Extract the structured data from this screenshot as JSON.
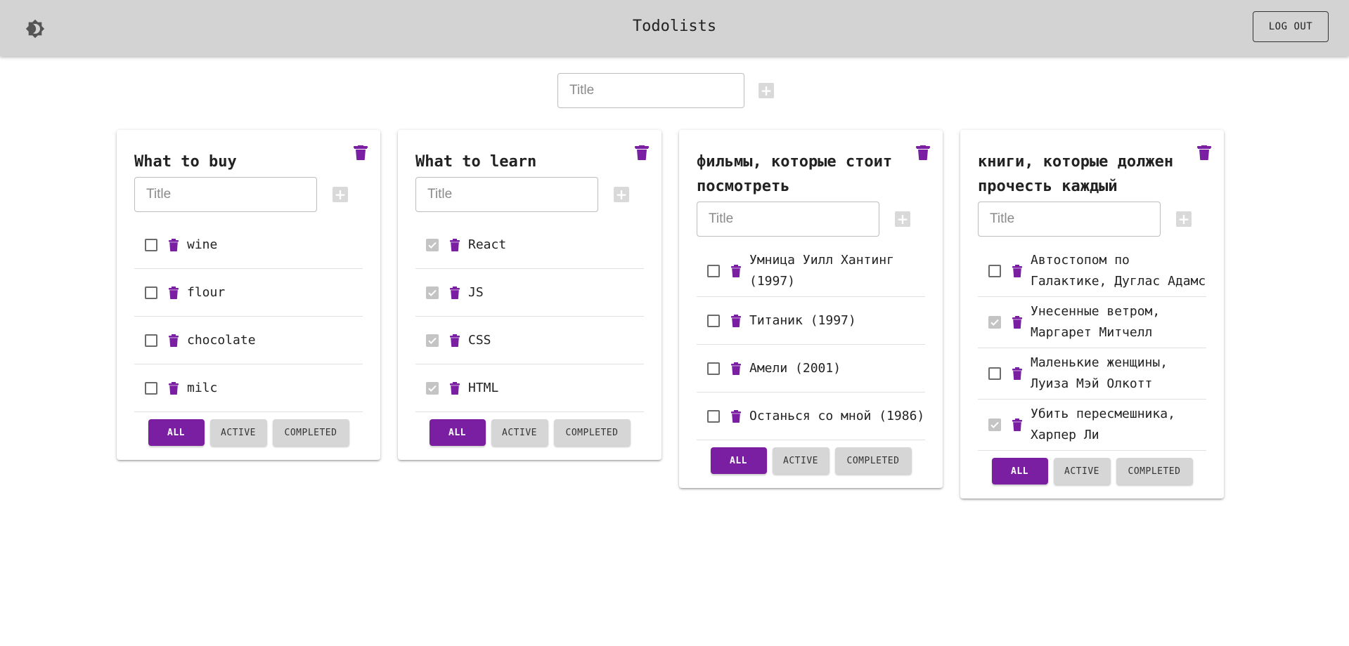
{
  "header": {
    "title": "Todolists",
    "logout_label": "LOG OUT",
    "theme_icon": "brightness-icon"
  },
  "new_list": {
    "placeholder": "Title",
    "add_icon": "plus-icon"
  },
  "colors": {
    "accent": "#7b1fa2",
    "appbar": "#d3d3d3",
    "checked": "#c4c4c4"
  },
  "filters": {
    "all": "ALL",
    "active": "ACTIVE",
    "completed": "COMPLETED",
    "selected": "ALL"
  },
  "lists": [
    {
      "title": "What to buy",
      "placeholder": "Title",
      "tasks": [
        {
          "text": "wine",
          "done": false
        },
        {
          "text": "flour",
          "done": false
        },
        {
          "text": "chocolate",
          "done": false
        },
        {
          "text": "milc",
          "done": false
        }
      ]
    },
    {
      "title": "What to learn",
      "placeholder": "Title",
      "tasks": [
        {
          "text": "React",
          "done": true
        },
        {
          "text": "JS",
          "done": true
        },
        {
          "text": "CSS",
          "done": true
        },
        {
          "text": "HTML",
          "done": true
        }
      ]
    },
    {
      "title": "фильмы, которые стоит посмотреть",
      "placeholder": "Title",
      "tasks": [
        {
          "text": "Умница Уилл Хантинг (1997)",
          "done": false
        },
        {
          "text": "Титаник (1997)",
          "done": false
        },
        {
          "text": "Амели (2001)",
          "done": false
        },
        {
          "text": "Останься со мной (1986)",
          "done": false
        }
      ]
    },
    {
      "title": "книги, которые должен прочесть каждый",
      "placeholder": "Title",
      "tasks": [
        {
          "text": "Автостопом по Галактике, Дуглас Адамс",
          "done": false
        },
        {
          "text": "Унесенные ветром, Маргарет Митчелл",
          "done": true
        },
        {
          "text": "Маленькие женщины, Луиза Мэй Олкотт",
          "done": false
        },
        {
          "text": "Убить пересмешника, Харпер Ли",
          "done": true
        }
      ]
    }
  ]
}
